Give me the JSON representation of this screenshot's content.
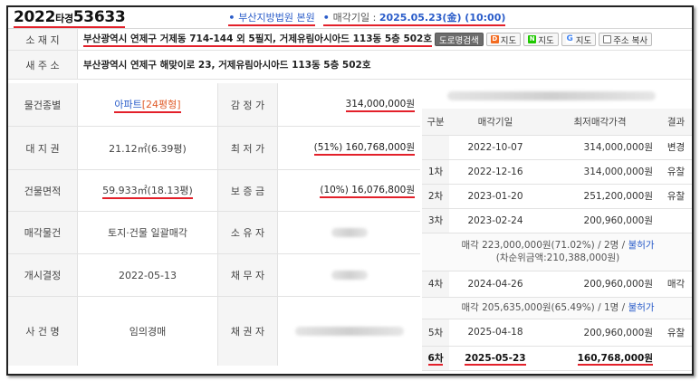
{
  "header": {
    "case_year": "2022",
    "case_type": "타경",
    "case_num": "53633",
    "court_link": "부산지방법원 본원",
    "sale_date_label": "매각기일 : ",
    "sale_date": "2025.05.23(金) (10:00)"
  },
  "location": {
    "label": "소 재 지",
    "address": "부산광역시 연제구 거제동 714-144 외 5필지, 거제유림아시아드 113동 5층 502호",
    "buttons": {
      "road_search": "도로명검색",
      "map_d": "지도",
      "map_n": "지도",
      "map_g": "지도",
      "copy_address": "주소 복사"
    }
  },
  "new_address": {
    "label": "새 주 소",
    "address": "부산광역시 연제구 해맞이로 23, 거제유림아시아드 113동 5층 502호"
  },
  "details": [
    {
      "label": "물건종별",
      "value": "아파트",
      "value_extra": "[24평형]",
      "label2": "감 정 가",
      "value2": "314,000,000원"
    },
    {
      "label": "대 지 권",
      "value": "21.12㎡(6.39평)",
      "label2": "최 저 가",
      "value2": "(51%) 160,768,000원"
    },
    {
      "label": "건물면적",
      "value": "59.933㎡(18.13평)",
      "label2": "보 증 금",
      "value2": "(10%) 16,076,800원"
    },
    {
      "label": "매각물건",
      "value": "토지·건물 일괄매각",
      "label2": "소 유 자",
      "value2": ""
    },
    {
      "label": "개시결정",
      "value": "2022-05-13",
      "label2": "채 무 자",
      "value2": ""
    },
    {
      "label": "사 건 명",
      "value": "임의경매",
      "label2": "채 권 자",
      "value2": ""
    }
  ],
  "history": {
    "headers": [
      "구분",
      "매각기일",
      "최저매각가격",
      "결과"
    ],
    "rows": [
      {
        "round": "",
        "date": "2022-10-07",
        "price": "314,000,000원",
        "result": "변경"
      },
      {
        "round": "1차",
        "date": "2022-12-16",
        "price": "314,000,000원",
        "result": "유찰"
      },
      {
        "round": "2차",
        "date": "2023-01-20",
        "price": "251,200,000원",
        "result": "유찰"
      },
      {
        "round": "3차",
        "date": "2023-02-24",
        "price": "200,960,000원",
        "result": ""
      }
    ],
    "sale1_line1_prefix": "매각 223,000,000원(71.02%) / 2명 / ",
    "sale1_line1_link": "불허가",
    "sale1_line2": "(차순위금액:210,388,000원)",
    "rows2": [
      {
        "round": "4차",
        "date": "2024-04-26",
        "price": "200,960,000원",
        "result": "매각"
      }
    ],
    "sale2_prefix": "매각 205,635,000원(65.49%) / 1명 / ",
    "sale2_link": "불허가",
    "rows3": [
      {
        "round": "5차",
        "date": "2025-04-18",
        "price": "200,960,000원",
        "result": "유찰"
      },
      {
        "round": "6차",
        "date": "2025-05-23",
        "price": "160,768,000원",
        "result": ""
      }
    ]
  },
  "colors": {
    "accent_red": "#e3202a",
    "link_blue": "#2a5cc9",
    "label_bg": "#f5f5f5"
  }
}
